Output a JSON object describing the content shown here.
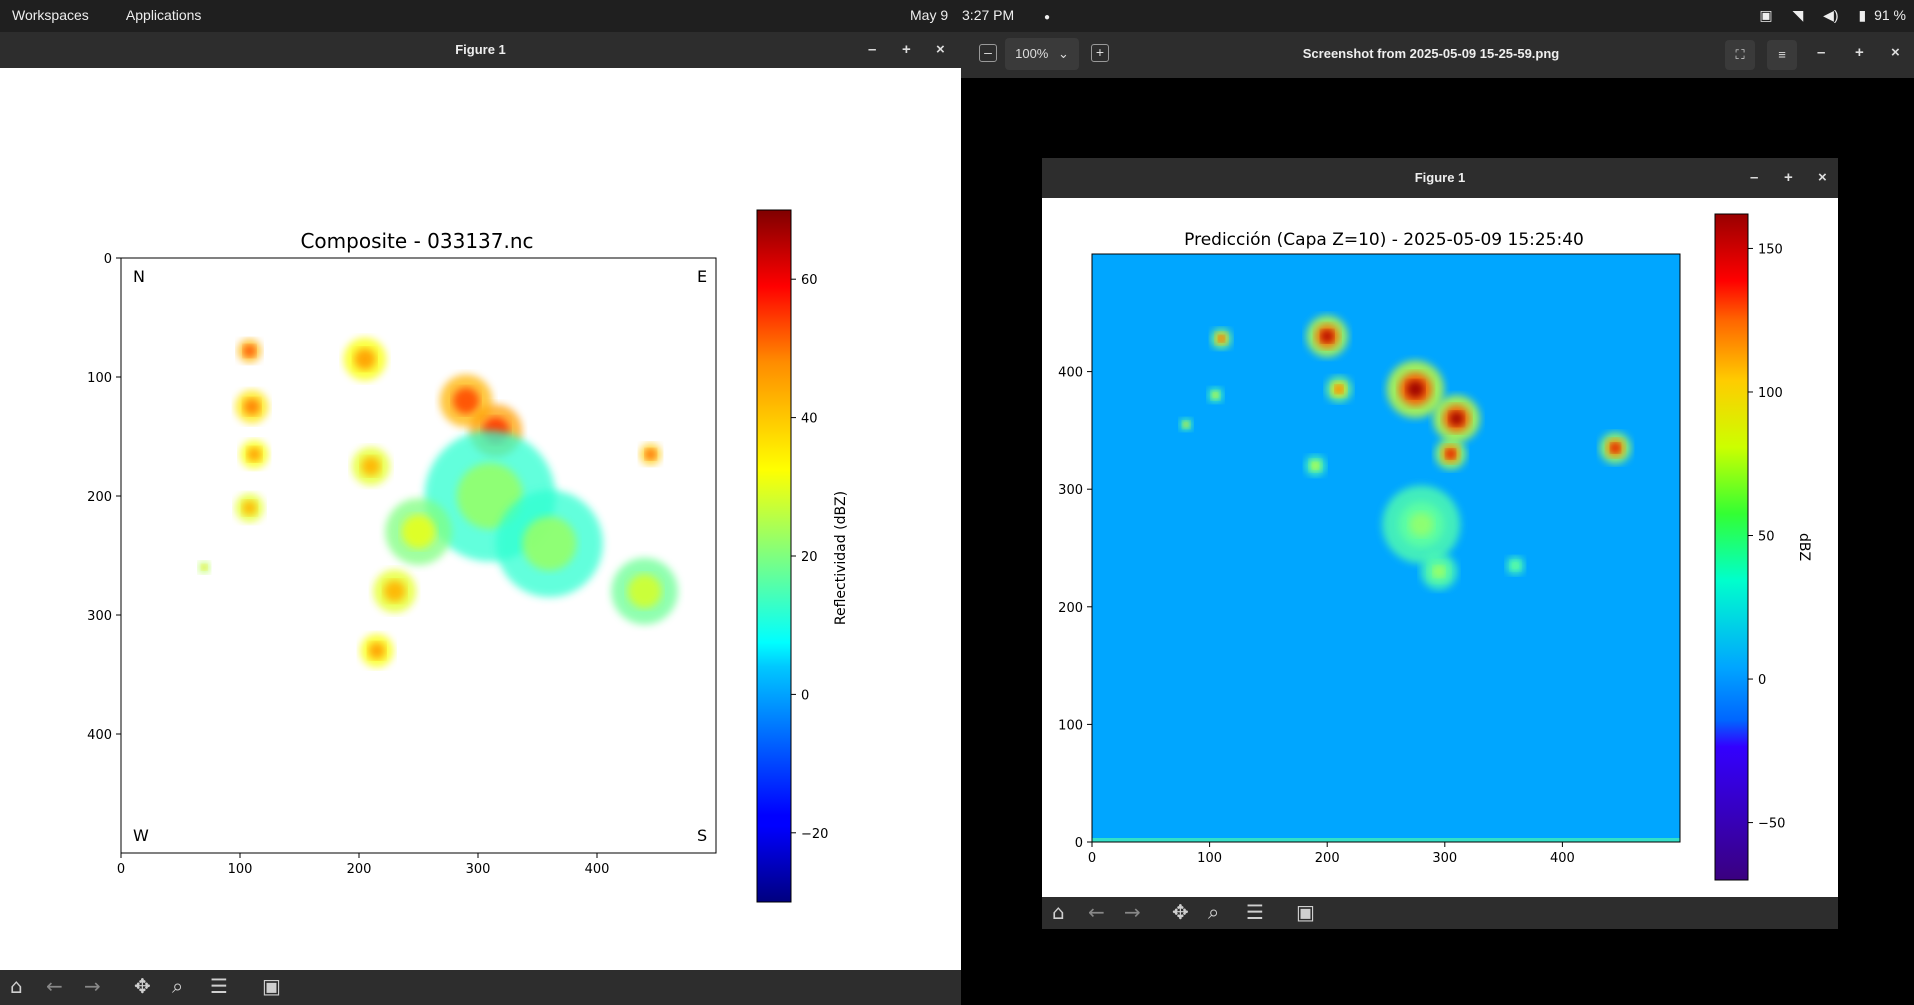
{
  "topbar": {
    "workspaces": "Workspaces",
    "applications": "Applications",
    "date": "May 9",
    "time": "3:27 PM",
    "dot": "●",
    "battery": "91 %"
  },
  "figure_left": {
    "window_title": "Figure 1",
    "min": "–",
    "max": "+",
    "close": "×"
  },
  "viewer": {
    "zoom": "100%",
    "title": "Screenshot from 2025-05-09 15-25-59.png",
    "min": "–",
    "max": "+",
    "close": "×",
    "inner_title": "Figure 1"
  },
  "toolbar_icons": [
    "home-icon",
    "back-arrow-icon",
    "forward-arrow-icon",
    "pan-icon",
    "zoom-icon",
    "configure-icon",
    "save-icon"
  ],
  "chart_data": [
    {
      "type": "heatmap",
      "title": "Composite - 033137.nc",
      "xlabel": "",
      "ylabel": "",
      "xlim": [
        0,
        500
      ],
      "ylim": [
        500,
        0
      ],
      "x_ticks": [
        0,
        100,
        200,
        300,
        400
      ],
      "y_ticks": [
        0,
        100,
        200,
        300,
        400
      ],
      "corner_labels": {
        "top_left": "N",
        "top_right": "E",
        "bottom_left": "W",
        "bottom_right": "S"
      },
      "colorbar": {
        "label": "Reflectividad (dBZ)",
        "range": [
          -30,
          70
        ],
        "ticks": [
          -20,
          0,
          20,
          40,
          60
        ],
        "tick_labels": [
          "−20",
          "0",
          "20",
          "40",
          "60"
        ],
        "colormap": "jet"
      },
      "background": "#ffffff",
      "cells": [
        {
          "x": 108,
          "y": 78,
          "r": 10,
          "dbz": 50
        },
        {
          "x": 110,
          "y": 125,
          "r": 14,
          "dbz": 45
        },
        {
          "x": 112,
          "y": 165,
          "r": 12,
          "dbz": 42
        },
        {
          "x": 108,
          "y": 210,
          "r": 12,
          "dbz": 40
        },
        {
          "x": 205,
          "y": 85,
          "r": 18,
          "dbz": 42
        },
        {
          "x": 210,
          "y": 175,
          "r": 16,
          "dbz": 40
        },
        {
          "x": 290,
          "y": 120,
          "r": 22,
          "dbz": 50
        },
        {
          "x": 315,
          "y": 145,
          "r": 22,
          "dbz": 52
        },
        {
          "x": 310,
          "y": 200,
          "r": 55,
          "dbz": 22
        },
        {
          "x": 360,
          "y": 240,
          "r": 45,
          "dbz": 22
        },
        {
          "x": 250,
          "y": 230,
          "r": 28,
          "dbz": 30
        },
        {
          "x": 230,
          "y": 280,
          "r": 18,
          "dbz": 40
        },
        {
          "x": 215,
          "y": 330,
          "r": 14,
          "dbz": 42
        },
        {
          "x": 440,
          "y": 280,
          "r": 28,
          "dbz": 28
        },
        {
          "x": 445,
          "y": 165,
          "r": 9,
          "dbz": 48
        },
        {
          "x": 70,
          "y": 260,
          "r": 5,
          "dbz": 35
        }
      ]
    },
    {
      "type": "heatmap",
      "title": "Predicción (Capa Z=10) - 2025-05-09 15:25:40",
      "xlabel": "",
      "ylabel": "",
      "xlim": [
        0,
        500
      ],
      "ylim": [
        0,
        500
      ],
      "x_ticks": [
        0,
        100,
        200,
        300,
        400
      ],
      "y_ticks": [
        0,
        100,
        200,
        300,
        400
      ],
      "colorbar": {
        "label": "dBZ",
        "range": [
          -70,
          162
        ],
        "ticks": [
          -50,
          0,
          50,
          100,
          150
        ],
        "tick_labels": [
          "−50",
          "0",
          "50",
          "100",
          "150"
        ],
        "colormap": "jet"
      },
      "background_value": 0,
      "cells": [
        {
          "x": 200,
          "y": 430,
          "r": 16,
          "dbz": 150
        },
        {
          "x": 210,
          "y": 385,
          "r": 10,
          "dbz": 110
        },
        {
          "x": 275,
          "y": 385,
          "r": 22,
          "dbz": 155
        },
        {
          "x": 310,
          "y": 360,
          "r": 18,
          "dbz": 155
        },
        {
          "x": 305,
          "y": 330,
          "r": 12,
          "dbz": 140
        },
        {
          "x": 445,
          "y": 335,
          "r": 12,
          "dbz": 140
        },
        {
          "x": 110,
          "y": 428,
          "r": 8,
          "dbz": 120
        },
        {
          "x": 105,
          "y": 380,
          "r": 6,
          "dbz": 70
        },
        {
          "x": 190,
          "y": 320,
          "r": 8,
          "dbz": 60
        },
        {
          "x": 280,
          "y": 270,
          "r": 30,
          "dbz": 40
        },
        {
          "x": 295,
          "y": 230,
          "r": 14,
          "dbz": 45
        },
        {
          "x": 360,
          "y": 235,
          "r": 7,
          "dbz": 35
        },
        {
          "x": 80,
          "y": 355,
          "r": 5,
          "dbz": 80
        }
      ]
    }
  ]
}
